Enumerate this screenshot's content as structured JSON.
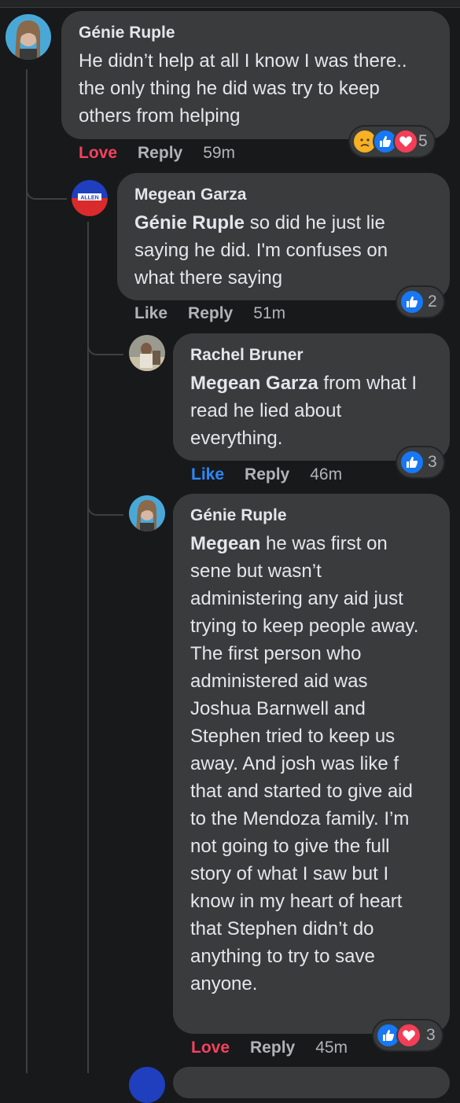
{
  "comments": [
    {
      "author": "Génie Ruple",
      "text": "He didn’t help at all I know I was there.. the only thing he did was try to keep others from helping",
      "action_1": "Love",
      "action_2": "Reply",
      "time": "59m",
      "reaction_count": "5",
      "reaction_icons": [
        "sad-icon",
        "like-icon",
        "love-icon"
      ]
    },
    {
      "author": "Megean Garza",
      "mention": "Génie Ruple",
      "text": " so did he just lie saying he did. I'm confuses on what there saying",
      "action_1": "Like",
      "action_2": "Reply",
      "time": "51m",
      "reaction_count": "2",
      "reaction_icons": [
        "like-icon"
      ],
      "avatar_text": "ALLEN"
    },
    {
      "author": "Rachel Bruner",
      "mention": "Megean Garza",
      "text": " from what I read he lied about everything.",
      "action_1": "Like",
      "action_2": "Reply",
      "time": "46m",
      "reaction_count": "3",
      "reaction_icons": [
        "like-icon"
      ]
    },
    {
      "author": "Génie Ruple",
      "mention": "Megean",
      "text": " he was first on sene but wasn’t administering any aid just trying to keep people away. The first person who administered aid was Joshua Barnwell and Stephen tried to keep us away. And josh was like f that and started to give aid to the Mendoza family. I’m not going to give the full story of what I saw but I know in my heart of heart that Stephen didn’t do anything to try to save anyone.",
      "action_1": "Love",
      "action_2": "Reply",
      "time": "45m",
      "reaction_count": "3",
      "reaction_icons": [
        "like-icon",
        "love-icon"
      ]
    }
  ],
  "colors": {
    "background": "#18191a",
    "bubble": "#3a3b3c",
    "love_red": "#f3425f",
    "like_blue": "#2d88ff",
    "muted": "#b0b3b8"
  }
}
